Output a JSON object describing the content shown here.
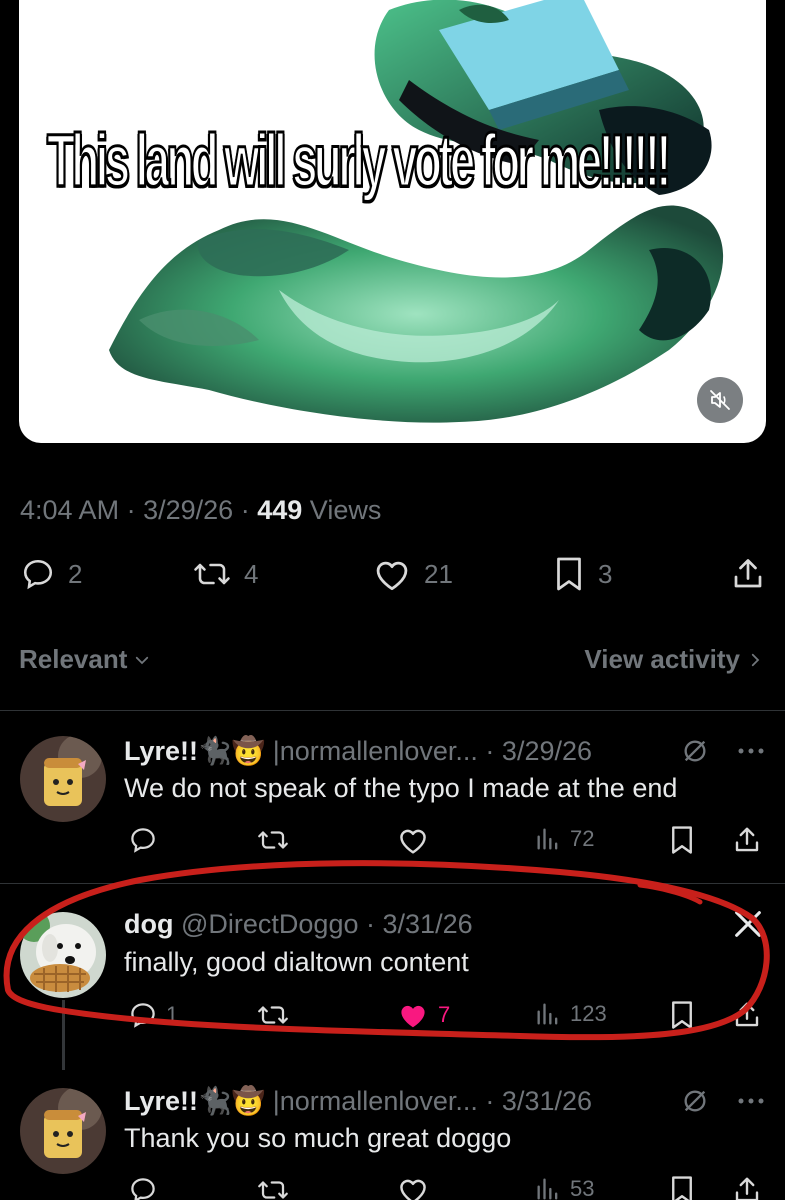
{
  "post": {
    "caption": "This land will surly vote for me!!!!!!",
    "time": "4:04 AM",
    "date": "3/29/26",
    "views_count": "449",
    "views_label": "Views",
    "sep": "·",
    "replies": "2",
    "reposts": "4",
    "likes": "21",
    "bookmarks": "3"
  },
  "sort": {
    "relevant": "Relevant",
    "view_activity": "View activity"
  },
  "replies": [
    {
      "name": "Lyre!!🐈‍⬛🤠",
      "handle": "|normallenlover...",
      "date": "3/29/26",
      "text": "We do not speak of the typo I made at the end",
      "replies": "",
      "reposts": "",
      "likes": "",
      "views": "72"
    },
    {
      "name": "dog",
      "handle": "@DirectDoggo",
      "date": "3/31/26",
      "text": "finally, good dialtown content",
      "replies": "1",
      "reposts": "",
      "likes": "7",
      "views": "123"
    },
    {
      "name": "Lyre!!🐈‍⬛🤠",
      "handle": "|normallenlover...",
      "date": "3/31/26",
      "text": "Thank you so much great doggo",
      "replies": "",
      "reposts": "",
      "likes": "",
      "views": "53"
    }
  ],
  "colors": {
    "background": "#000000",
    "muted": "#71767b",
    "like": "#f91880",
    "annotation": "#c8201b"
  }
}
